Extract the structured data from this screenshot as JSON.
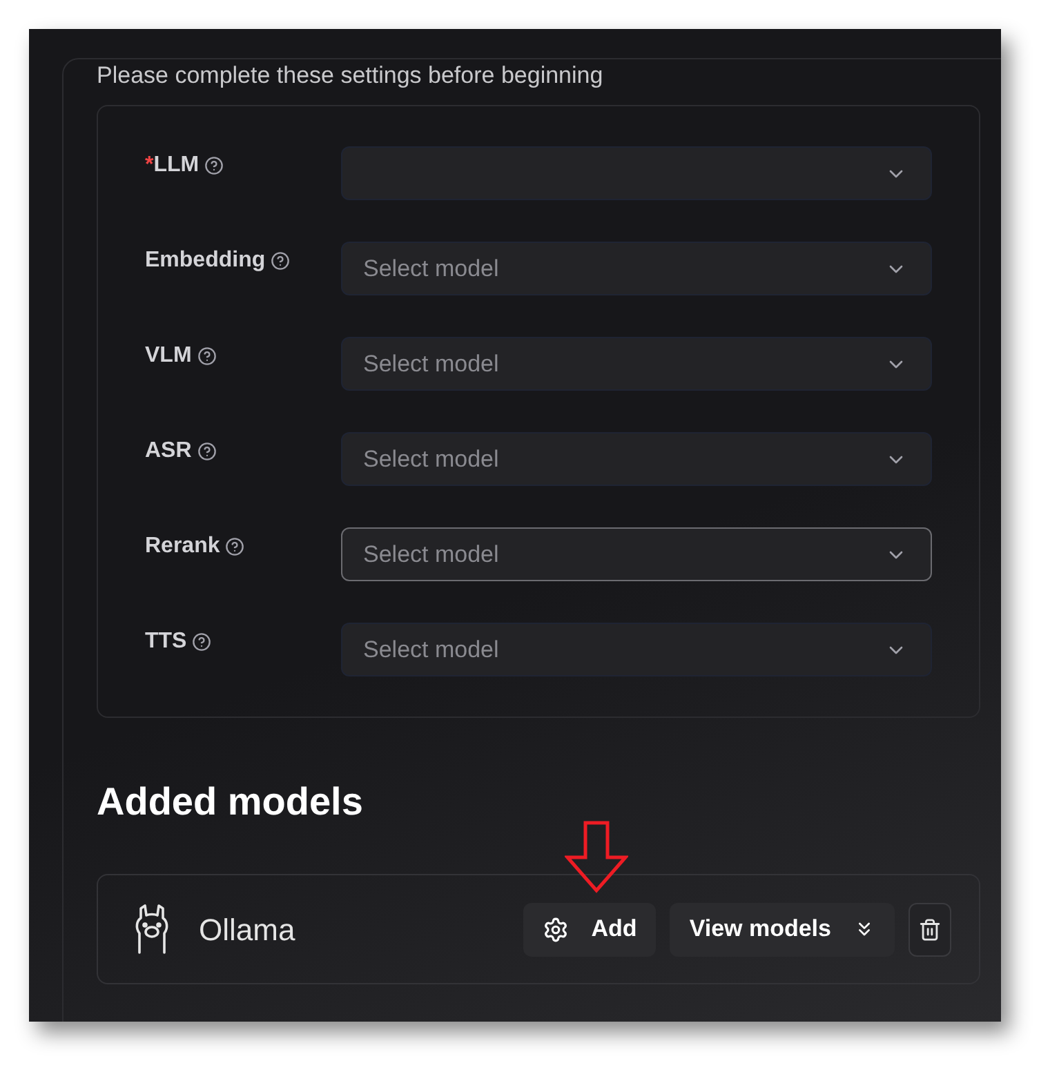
{
  "intro": "Please complete these settings before beginning",
  "settings": [
    {
      "label": "LLM",
      "required": true,
      "focused": false
    },
    {
      "label": "Embedding",
      "required": false,
      "placeholder": "Select model",
      "focused": false
    },
    {
      "label": "VLM",
      "required": false,
      "placeholder": "Select model",
      "focused": false
    },
    {
      "label": "ASR",
      "required": false,
      "placeholder": "Select model",
      "focused": false
    },
    {
      "label": "Rerank",
      "required": false,
      "placeholder": "Select model",
      "focused": true
    },
    {
      "label": "TTS",
      "required": false,
      "placeholder": "Select model",
      "focused": false
    }
  ],
  "required_mark": "*",
  "added_models": {
    "title": "Added models",
    "providers": [
      {
        "name": "Ollama",
        "add_label": "Add",
        "view_label": "View models",
        "highlighted": true
      }
    ]
  }
}
